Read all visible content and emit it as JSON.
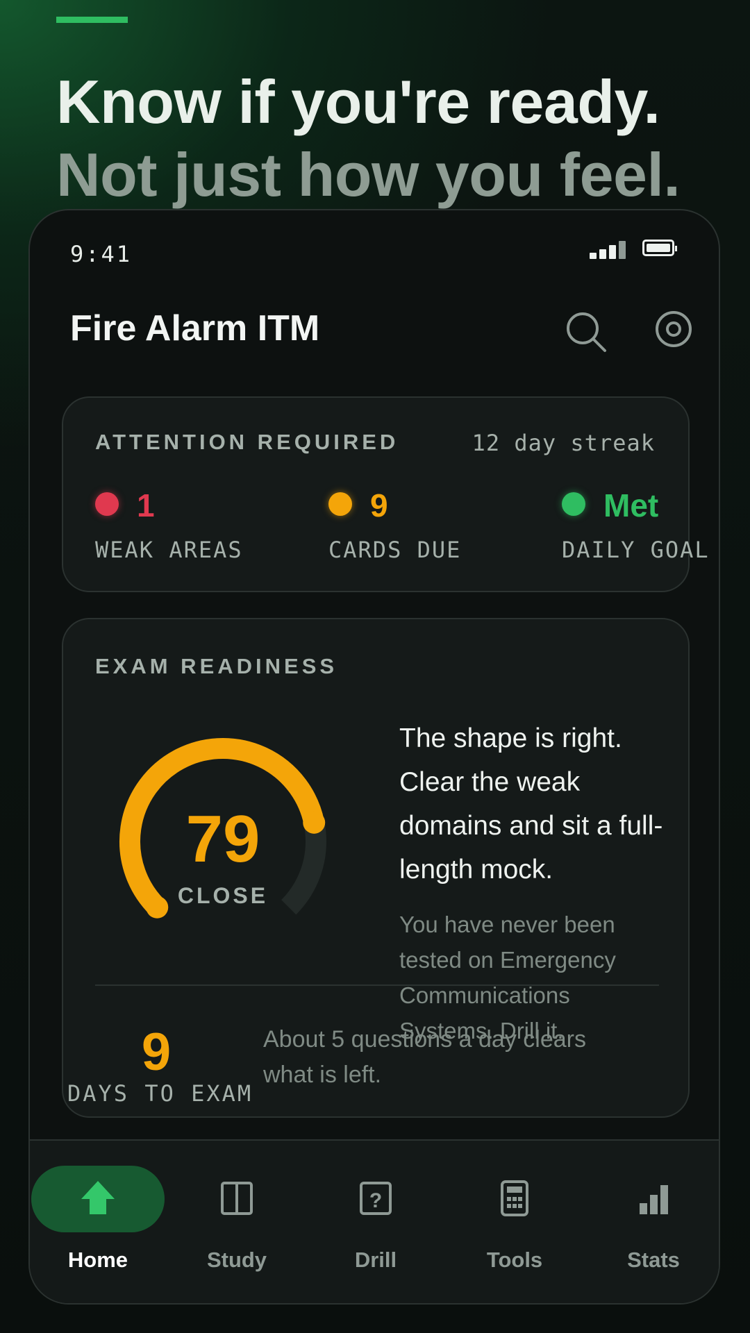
{
  "hero": {
    "line1": "Know if you're ready.",
    "line2": "Not just how you feel."
  },
  "status_bar": {
    "time": "9:41"
  },
  "header": {
    "title": "Fire Alarm ITM"
  },
  "attention": {
    "label": "ATTENTION REQUIRED",
    "streak": "12 day streak",
    "metrics": [
      {
        "value": "1",
        "label": "WEAK AREAS",
        "color": "#e0394f"
      },
      {
        "value": "9",
        "label": "CARDS DUE",
        "color": "#f4a509"
      },
      {
        "value": "Met",
        "label": "DAILY GOAL",
        "color": "#2fbd61"
      }
    ]
  },
  "readiness": {
    "label": "EXAM READINESS",
    "score": "79",
    "score_value": 79,
    "band": "CLOSE",
    "headline": "The shape is right. Clear the weak domains and sit a full-length mock.",
    "detail": "You have never been tested on Emergency Communications Systems. Drill it.",
    "days_to_exam": "9",
    "days_label": "DAYS TO EXAM",
    "days_text": "About 5 questions a day clears what is left."
  },
  "colors": {
    "accent_green": "#2fbd61",
    "amber": "#f4a509",
    "red": "#e0394f",
    "background": "#0d1110",
    "card": "#151a19"
  },
  "tabs": [
    {
      "label": "Home",
      "icon": "home-icon",
      "active": true
    },
    {
      "label": "Study",
      "icon": "book-icon",
      "active": false
    },
    {
      "label": "Drill",
      "icon": "question-icon",
      "active": false
    },
    {
      "label": "Tools",
      "icon": "calculator-icon",
      "active": false
    },
    {
      "label": "Stats",
      "icon": "bar-chart-icon",
      "active": false
    }
  ]
}
